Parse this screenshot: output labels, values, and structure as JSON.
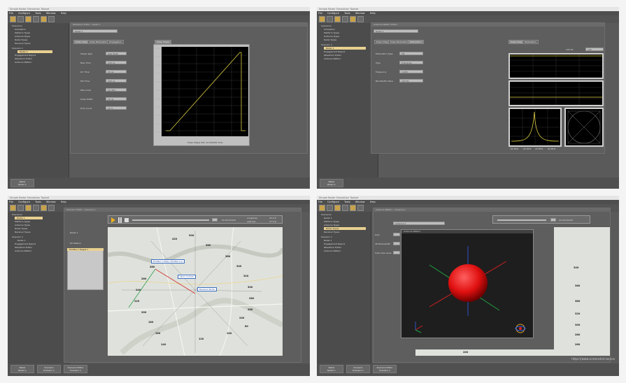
{
  "app": {
    "title": "Simple Radar Simulation Toolset",
    "menu": [
      "File",
      "Configure",
      "Tools",
      "Window",
      "Help"
    ]
  },
  "sidebar": {
    "tree_top": [
      "Scenarios",
      "Radar 1",
      "Simulation",
      "Platform Types",
      "Antenna Types",
      "Radar Types",
      "Receiver Types"
    ],
    "tree_bottom": [
      "Scenario 1",
      "Radar 1",
      "Targets",
      "Engagement Report",
      "Waveform Editor",
      "Antenna Pattern"
    ],
    "selected": "Radar 1"
  },
  "dock": {
    "btn1": [
      "Radar",
      "Radar 1"
    ],
    "btn2": [
      "Scenario",
      "Scenario 1"
    ],
    "btn3": [
      "Scenario Editor",
      "Scenario 1"
    ]
  },
  "q1": {
    "window_title": "Waveform Editor - Radar 1",
    "name_field": "Radar 1",
    "tabs": [
      "Pulse Shape",
      "Pulse Modulation",
      "Propagation"
    ],
    "fields": [
      {
        "label": "Shape Type",
        "value": "Saw Tooth"
      },
      {
        "label": "Rise Time",
        "value": "100 ns"
      },
      {
        "label": "On Time",
        "value": "10 us"
      },
      {
        "label": "Fall Time",
        "value": "100 ns"
      },
      {
        "label": "Max Ampl.",
        "value": "10 dBm"
      },
      {
        "label": "Pulse Width",
        "value": "10 us"
      },
      {
        "label": "Duty Cycle",
        "value": "10 %"
      }
    ],
    "graph_tab": "Pulse Shape",
    "y_ticks": [
      "1.0",
      "0.9",
      "0.8",
      "0.7",
      "0.6",
      "0.5",
      "0.4",
      "0.3",
      "0.2",
      "0.1",
      "0.0"
    ],
    "caption": "Pulse Shape 000 +0.000001 time"
  },
  "q2": {
    "window_title": "Antenna Pattern Editor",
    "name_field": "Radar 1",
    "tabs": [
      "Pulse Shape",
      "Pulse Modulation",
      "Modulation"
    ],
    "right_tabs": [
      "Pulse Shape",
      "Modulation"
    ],
    "top_value": "100 Hz",
    "top_field": "100",
    "fields": [
      {
        "label": "Modulation Type",
        "value": "FM"
      },
      {
        "label": "Type",
        "value": "Triangular"
      },
      {
        "label": "Frequency",
        "value": "1 GHz"
      },
      {
        "label": "Bandwidth Value",
        "value": "100 Hz"
      }
    ],
    "spectrum_ticks": [
      "-60 MHz",
      "-20 MHz",
      "20 MHz",
      "60 MHz"
    ]
  },
  "q3": {
    "window_title": "Scenario Editor - Scenario 1",
    "list": [
      "Radar 1",
      "RX Station",
      "Emitter 1 Target 1"
    ],
    "time": "00:00:00.000",
    "coords": [
      "Longitude",
      "Latitude"
    ],
    "coord_vals": [
      "43.2 E",
      "37.5 N"
    ],
    "callouts": [
      "Emitter 1 Sites / Emitter Loc",
      "18.3 / 1.4 km",
      "Receiver Node"
    ],
    "map_numbers": [
      "420",
      "300",
      "280",
      "260",
      "240",
      "220",
      "200",
      "180",
      "160",
      "140",
      "120",
      "100",
      "80",
      "380",
      "360",
      "340",
      "320",
      "300",
      "280",
      "260",
      "240",
      "220",
      "200",
      "180",
      "160"
    ]
  },
  "q4": {
    "window_title": "Antenna Pattern - Antenna 1",
    "popup_title": "Antenna Pattern",
    "name_field": "Antenna 1",
    "left_labels": [
      "Gain",
      "3D Beamwidth",
      "Side Lobe Level"
    ],
    "time": "00:00:00.000",
    "map_numbers": [
      "200",
      "260",
      "280",
      "300",
      "320",
      "340",
      "360",
      "380",
      "220"
    ],
    "colors": {
      "lobe": "#e01010",
      "axis_x": "#d02020",
      "axis_y": "#20a040",
      "axis_z": "#3050c0"
    }
  },
  "watermark": "https://www.screenshot-source"
}
